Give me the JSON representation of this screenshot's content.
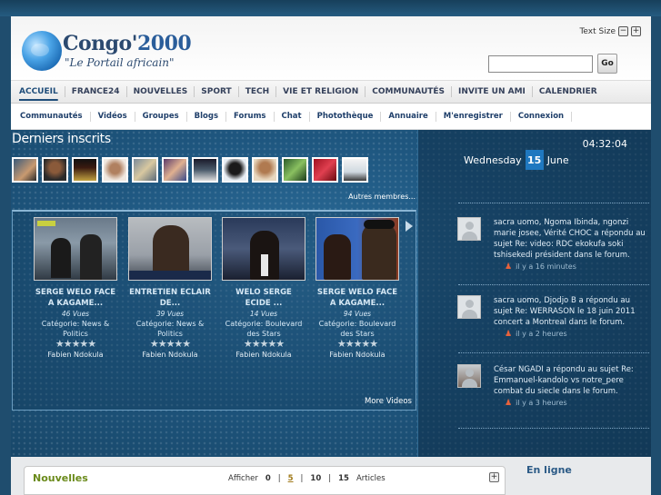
{
  "header": {
    "logo_name": "Congo'",
    "logo_number": "2000",
    "logo_tagline": "\"Le Portail africain\"",
    "text_size_label": "Text Size",
    "text_minus": "−",
    "text_plus": "+",
    "search_placeholder": "",
    "search_button": "Go"
  },
  "main_nav": [
    "ACCUEIL",
    "FRANCE24",
    "NOUVELLES",
    "SPORT",
    "TECH",
    "VIE ET RELIGION",
    "COMMUNAUTÉS",
    "INVITE UN AMI",
    "CALENDRIER"
  ],
  "sub_nav": [
    "Communautés",
    "Vidéos",
    "Groupes",
    "Blogs",
    "Forums",
    "Chat",
    "Photothèque",
    "Annuaire",
    "M'enregistrer",
    "Connexion"
  ],
  "members": {
    "title": "Derniers inscrits",
    "more_link": "Autres membres..."
  },
  "videos": {
    "items": [
      {
        "title1": "SERGE WELO FACE",
        "title2": "A KAGAME...",
        "views": "46 Vues",
        "cat1": "Catégorie: News &",
        "cat2": "Politics",
        "author": "Fabien Ndokula"
      },
      {
        "title1": "ENTRETIEN ECLAIR",
        "title2": "DE...",
        "views": "39 Vues",
        "cat1": "Catégorie: News &",
        "cat2": "Politics",
        "author": "Fabien Ndokula"
      },
      {
        "title1": "WELO SERGE",
        "title2": "ECIDE ...",
        "views": "14 Vues",
        "cat1": "Catégorie: Boulevard",
        "cat2": "des Stars",
        "author": "Fabien Ndokula"
      },
      {
        "title1": "SERGE WELO FACE",
        "title2": "A KAGAME...",
        "views": "94 Vues",
        "cat1": "Catégorie: Boulevard",
        "cat2": "des Stars",
        "author": "Fabien Ndokula"
      }
    ],
    "stars": "★★★★★",
    "more_link": "More Videos"
  },
  "clock": {
    "time": "04:32:04",
    "weekday": "Wednesday",
    "day": "15",
    "month": "June"
  },
  "activity": [
    {
      "text": "sacra uomo, Ngoma Ibinda, ngonzi marie josee, Vérité CHOC a répondu au sujet Re: video: RDC ekokufa soki tshisekedi président dans le forum.",
      "when": "il y a 16 minutes"
    },
    {
      "text": "sacra uomo, Djodjo B a répondu au sujet Re: WERRASON le 18 juin 2011 concert a Montreal dans le forum.",
      "when": "il y a 2 heures"
    },
    {
      "text": "César NGADI a répondu au sujet Re: Emmanuel-kandolo vs notre_pere combat du siecle dans le forum.",
      "when": "il y a 3 heures"
    }
  ],
  "bottom": {
    "nouvelles_title": "Nouvelles",
    "afficher": "Afficher",
    "opt0": "0",
    "opt5": "5",
    "opt10": "10",
    "opt15": "15",
    "articles": "Articles",
    "expand": "+",
    "online_title": "En ligne"
  },
  "colors": {
    "brand_blue": "#2c4a70",
    "hero_blue": "#1e567f",
    "date_badge": "#1f78c0",
    "nouvelles_green": "#6a8a1a"
  }
}
